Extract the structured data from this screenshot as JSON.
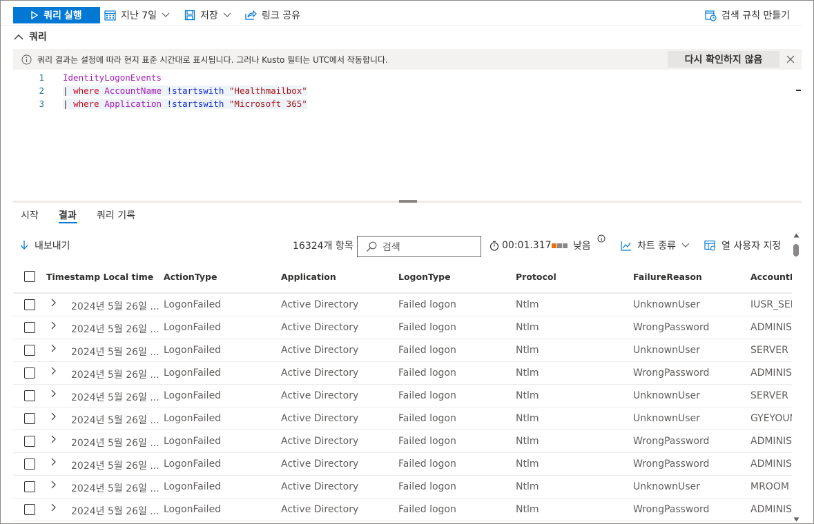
{
  "toolbar": {
    "run_label": "쿼리 실행",
    "time_range": "지난 7일",
    "save_label": "저장",
    "share_label": "링크 공유",
    "create_rule_label": "검색 규칙 만들기"
  },
  "query_section": {
    "title": "쿼리"
  },
  "infobar": {
    "message": "쿼리 결과는 설정에 따라 현지 표준 시간대로 표시됩니다. 그러나 Kusto 필터는 UTC에서 작동합니다.",
    "dismiss_label": "다시 확인하지 않음"
  },
  "editor": {
    "lines": [
      {
        "num": "1",
        "table": "IdentityLogonEvents"
      },
      {
        "num": "2",
        "pipe": "|",
        "op": "where",
        "column": "AccountName",
        "fn": "!startswith",
        "str": "\"Healthmailbox\""
      },
      {
        "num": "3",
        "pipe": "|",
        "op": "where",
        "column": "Application",
        "fn": "!startswith",
        "str": "\"Microsoft 365\""
      }
    ]
  },
  "tabs": [
    {
      "label": "시작"
    },
    {
      "label": "결과"
    },
    {
      "label": "쿼리 기록"
    }
  ],
  "results_toolbar": {
    "export_label": "내보내기",
    "count_label": "16324개 항목",
    "search_placeholder": "검색",
    "elapsed": "00:01.317",
    "latency_label": "낮음",
    "chart_type_label": "차트 종류",
    "customize_columns_label": "열 사용자 지정"
  },
  "colors": {
    "accent": "#0078d4",
    "latency_active": "#e97010",
    "latency_inactive": "#8a8886"
  },
  "table": {
    "columns": [
      "Timestamp Local time",
      "ActionType",
      "Application",
      "LogonType",
      "Protocol",
      "FailureReason",
      "AccountNa"
    ],
    "rows": [
      [
        "2024년 5월 26일 ...",
        "LogonFailed",
        "Active Directory",
        "Failed logon",
        "Ntlm",
        "UnknownUser",
        "IUSR_SER"
      ],
      [
        "2024년 5월 26일 ...",
        "LogonFailed",
        "Active Directory",
        "Failed logon",
        "Ntlm",
        "WrongPassword",
        "ADMINIS"
      ],
      [
        "2024년 5월 26일 ...",
        "LogonFailed",
        "Active Directory",
        "Failed logon",
        "Ntlm",
        "UnknownUser",
        "SERVER"
      ],
      [
        "2024년 5월 26일 ...",
        "LogonFailed",
        "Active Directory",
        "Failed logon",
        "Ntlm",
        "WrongPassword",
        "ADMINIS"
      ],
      [
        "2024년 5월 26일 ...",
        "LogonFailed",
        "Active Directory",
        "Failed logon",
        "Ntlm",
        "UnknownUser",
        "SERVER"
      ],
      [
        "2024년 5월 26일 ...",
        "LogonFailed",
        "Active Directory",
        "Failed logon",
        "Ntlm",
        "UnknownUser",
        "GYEYOUN"
      ],
      [
        "2024년 5월 26일 ...",
        "LogonFailed",
        "Active Directory",
        "Failed logon",
        "Ntlm",
        "WrongPassword",
        "ADMINIS"
      ],
      [
        "2024년 5월 26일 ...",
        "LogonFailed",
        "Active Directory",
        "Failed logon",
        "Ntlm",
        "WrongPassword",
        "ADMINIS"
      ],
      [
        "2024년 5월 26일 ...",
        "LogonFailed",
        "Active Directory",
        "Failed logon",
        "Ntlm",
        "UnknownUser",
        "MROOM"
      ],
      [
        "2024년 5월 26일 ...",
        "LogonFailed",
        "Active Directory",
        "Failed logon",
        "Ntlm",
        "WrongPassword",
        "ADMINIS"
      ]
    ]
  }
}
